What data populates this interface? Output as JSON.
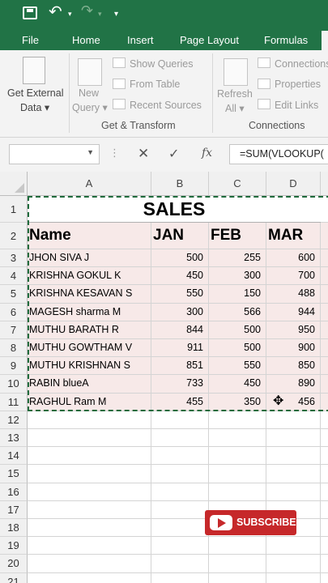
{
  "ribbon": {
    "tabs": [
      "File",
      "Home",
      "Insert",
      "Page Layout",
      "Formulas"
    ],
    "get_external_data": [
      "Get External",
      "Data ▾"
    ],
    "new_query": [
      "New",
      "Query ▾"
    ],
    "show_queries": "Show Queries",
    "from_table": "From Table",
    "recent_sources": "Recent Sources",
    "group_get_transform": "Get & Transform",
    "refresh_all": [
      "Refresh",
      "All ▾"
    ],
    "connections": "Connections",
    "properties": "Properties",
    "edit_links": "Edit Links",
    "group_connections": "Connections"
  },
  "formula_bar": {
    "name_box": "",
    "formula": "=SUM(VLOOKUP("
  },
  "columns": [
    "A",
    "B",
    "C",
    "D"
  ],
  "rows": [
    "1",
    "2",
    "3",
    "4",
    "5",
    "6",
    "7",
    "8",
    "9",
    "10",
    "11",
    "12",
    "13",
    "14",
    "15",
    "16",
    "17",
    "18",
    "19",
    "20",
    "21"
  ],
  "sheet": {
    "title": "SALES",
    "headers": [
      "Name",
      "JAN",
      "FEB",
      "MAR"
    ],
    "records": [
      {
        "name": "JHON SIVA J",
        "jan": "500",
        "feb": "255",
        "mar": "600"
      },
      {
        "name": "KRISHNA GOKUL K",
        "jan": "450",
        "feb": "300",
        "mar": "700"
      },
      {
        "name": "KRISHNA KESAVAN S",
        "jan": "550",
        "feb": "150",
        "mar": "488"
      },
      {
        "name": "MAGESH sharma M",
        "jan": "300",
        "feb": "566",
        "mar": "944"
      },
      {
        "name": "MUTHU BARATH R",
        "jan": "844",
        "feb": "500",
        "mar": "950"
      },
      {
        "name": "MUTHU GOWTHAM V",
        "jan": "911",
        "feb": "500",
        "mar": "900"
      },
      {
        "name": "MUTHU KRISHNAN S",
        "jan": "851",
        "feb": "550",
        "mar": "850"
      },
      {
        "name": "RABIN blueA",
        "jan": "733",
        "feb": "450",
        "mar": "890"
      },
      {
        "name": "RAGHUL Ram M",
        "jan": "455",
        "feb": "350",
        "mar": "456"
      }
    ]
  },
  "subscribe": "SUBSCRIBE",
  "colors": {
    "excel_green": "#217346",
    "data_fill": "#f7e9e8",
    "subscribe_red": "#c6282a"
  }
}
